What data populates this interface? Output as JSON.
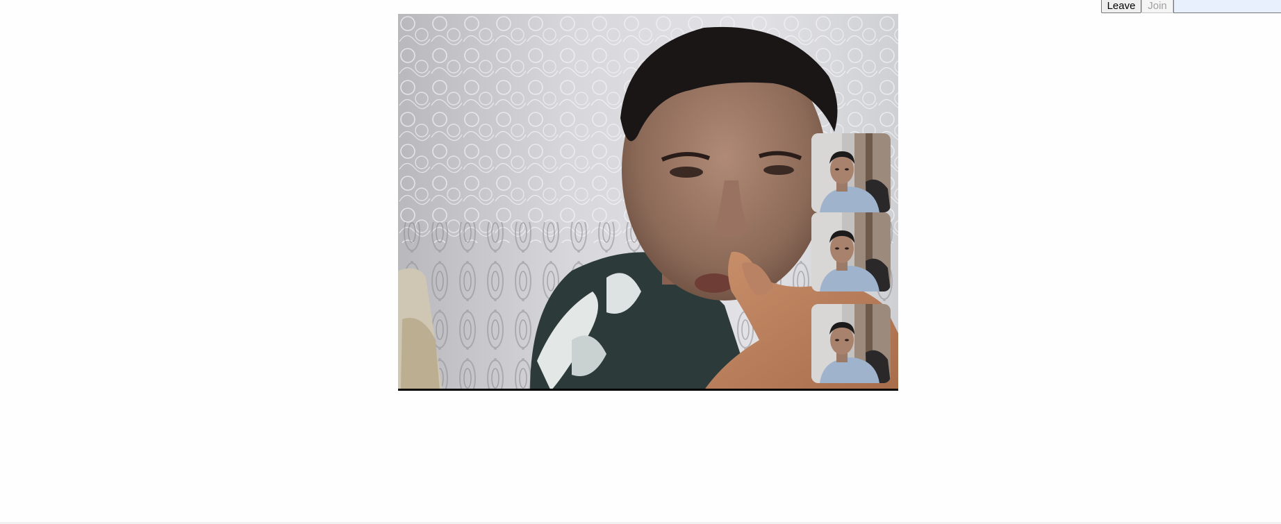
{
  "controls": {
    "leave_label": "Leave",
    "join_label": "Join",
    "room_input_value": "",
    "join_disabled": true
  },
  "main_video": {
    "icon": "remote-participant-video"
  },
  "thumbnails": [
    {
      "icon": "participant-video"
    },
    {
      "icon": "participant-video"
    },
    {
      "icon": "participant-video"
    }
  ],
  "colors": {
    "page_background": "#fefefe",
    "input_background": "#e8f0fe",
    "button_background": "#efefef",
    "disabled_text": "#a0a0a0"
  }
}
